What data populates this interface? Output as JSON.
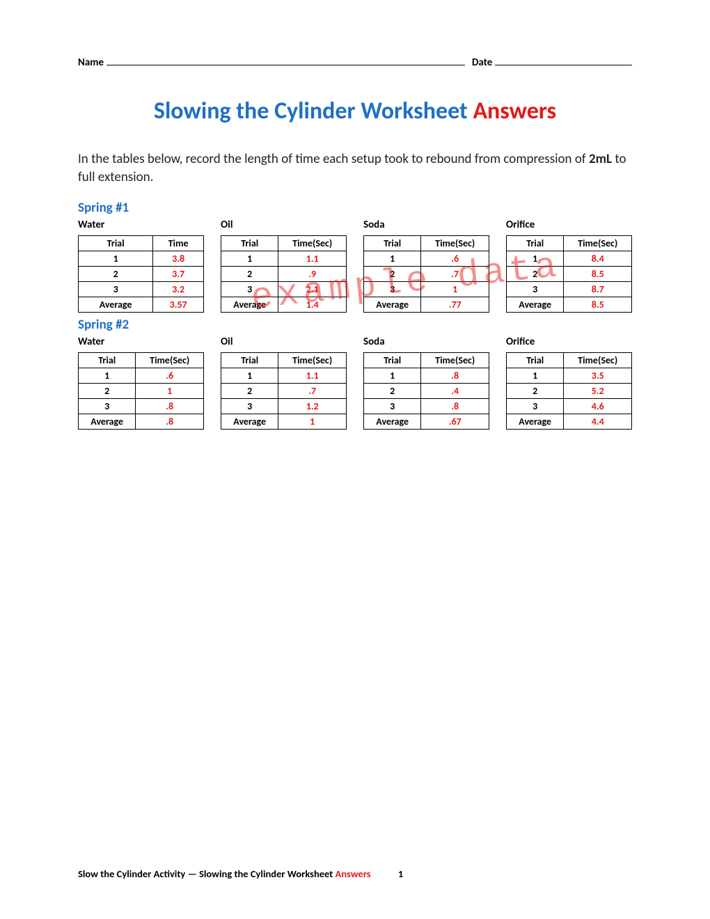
{
  "header": {
    "name_label": "Name",
    "date_label": "Date"
  },
  "title": {
    "main": "Slowing the Cylinder Worksheet",
    "answers": "Answers"
  },
  "intro": {
    "part1": "In the tables below, record the length of time each setup took to rebound from compression of ",
    "bold": "2mL",
    "part2": " to full extension."
  },
  "watermark": "example data",
  "springs": [
    {
      "heading": "Spring #1",
      "tables": [
        {
          "fluid": "Water",
          "col1": "Trial",
          "col2": "Time",
          "rows": [
            [
              "1",
              "3.8"
            ],
            [
              "2",
              "3.7"
            ],
            [
              "3",
              "3.2"
            ],
            [
              "Average",
              "3.57"
            ]
          ]
        },
        {
          "fluid": "Oil",
          "col1": "Trial",
          "col2": "Time(Sec)",
          "rows": [
            [
              "1",
              "1.1"
            ],
            [
              "2",
              ".9"
            ],
            [
              "3",
              "2.1"
            ],
            [
              "Average",
              "1.4"
            ]
          ]
        },
        {
          "fluid": "Soda",
          "col1": "Trial",
          "col2": "Time(Sec)",
          "rows": [
            [
              "1",
              ".6"
            ],
            [
              "2",
              ".7"
            ],
            [
              "3",
              "1"
            ],
            [
              "Average",
              ".77"
            ]
          ]
        },
        {
          "fluid": "Orifice",
          "col1": "Trial",
          "col2": "Time(Sec)",
          "rows": [
            [
              "1",
              "8.4"
            ],
            [
              "2",
              "8.5"
            ],
            [
              "3",
              "8.7"
            ],
            [
              "Average",
              "8.5"
            ]
          ]
        }
      ]
    },
    {
      "heading": "Spring #2",
      "tables": [
        {
          "fluid": "Water",
          "col1": "Trial",
          "col2": "Time(Sec)",
          "rows": [
            [
              "1",
              ".6"
            ],
            [
              "2",
              "1"
            ],
            [
              "3",
              ".8"
            ],
            [
              "Average",
              ".8"
            ]
          ]
        },
        {
          "fluid": "Oil",
          "col1": "Trial",
          "col2": "Time(Sec)",
          "rows": [
            [
              "1",
              "1.1"
            ],
            [
              "2",
              ".7"
            ],
            [
              "3",
              "1.2"
            ],
            [
              "Average",
              "1"
            ]
          ]
        },
        {
          "fluid": "Soda",
          "col1": "Trial",
          "col2": "Time(Sec)",
          "rows": [
            [
              "1",
              ".8"
            ],
            [
              "2",
              ".4"
            ],
            [
              "3",
              ".8"
            ],
            [
              "Average",
              ".67"
            ]
          ]
        },
        {
          "fluid": "Orifice",
          "col1": "Trial",
          "col2": "Time(Sec)",
          "rows": [
            [
              "1",
              "3.5"
            ],
            [
              "2",
              "5.2"
            ],
            [
              "3",
              "4.6"
            ],
            [
              "Average",
              "4.4"
            ]
          ]
        }
      ]
    }
  ],
  "footer": {
    "activity": "Slow the Cylinder Activity",
    "sep": "—",
    "title": "Slowing the Cylinder Worksheet",
    "answers": "Answers",
    "page": "1"
  }
}
